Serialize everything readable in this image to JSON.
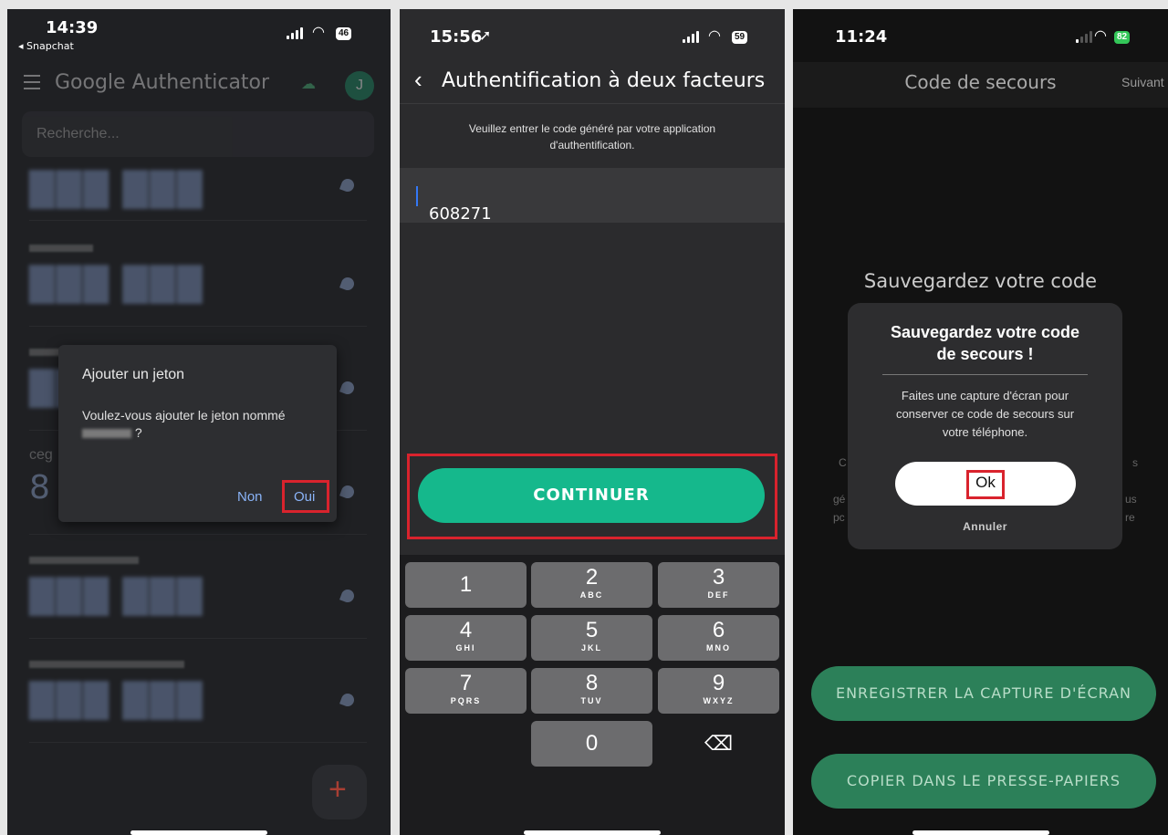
{
  "colors": {
    "highlight": "#d9232d",
    "teal": "#15b88c",
    "green": "#2c8059",
    "link_blue": "#8ab4f8"
  },
  "panel1": {
    "status": {
      "time": "14:39",
      "battery": "46",
      "back_app": "◂ Snapchat"
    },
    "app_title": "Google Authenticator",
    "avatar_letter": "J",
    "search_placeholder": "Recherche...",
    "token_partial_name": "ceg",
    "token_partial_code": "8",
    "dialog": {
      "title": "Ajouter un jeton",
      "message": "Voulez-vous ajouter le jeton nommé",
      "message_suffix": " ?",
      "no_label": "Non",
      "yes_label": "Oui"
    },
    "icons": [
      "menu-icon",
      "cloud-sync-icon",
      "countdown-pie-icon",
      "add-icon"
    ]
  },
  "panel2": {
    "status": {
      "time": "15:56",
      "location_arrow": "➚",
      "battery": "59"
    },
    "nav_title": "Authentification à deux facteurs",
    "instruction_line1": "Veuillez entrer le code généré par votre application",
    "instruction_line2": "d'authentification.",
    "code_value": "608271",
    "continue_label": "CONTINUER",
    "keys": [
      {
        "digit": "1",
        "letters": ""
      },
      {
        "digit": "2",
        "letters": "ABC"
      },
      {
        "digit": "3",
        "letters": "DEF"
      },
      {
        "digit": "4",
        "letters": "GHI"
      },
      {
        "digit": "5",
        "letters": "JKL"
      },
      {
        "digit": "6",
        "letters": "MNO"
      },
      {
        "digit": "7",
        "letters": "PQRS"
      },
      {
        "digit": "8",
        "letters": "TUV"
      },
      {
        "digit": "9",
        "letters": "WXYZ"
      },
      {
        "digit": "0",
        "letters": ""
      }
    ],
    "delete_symbol": "⌫"
  },
  "panel3": {
    "status": {
      "time": "11:24",
      "battery": "82"
    },
    "nav_title": "Code de secours",
    "nav_next": "Suivant",
    "bg_heading": "Sauvegardez votre code",
    "bg_fragments": [
      "C",
      "gé",
      "pc",
      "s",
      "us",
      "re"
    ],
    "dialog": {
      "title_line1": "Sauvegardez votre code",
      "title_line2": "de secours !",
      "msg_line1": "Faites une capture d'écran pour",
      "msg_line2": "conserver ce code de secours sur",
      "msg_line3": "votre téléphone.",
      "ok_label": "Ok",
      "cancel_label": "Annuler"
    },
    "save_screenshot_label": "ENREGISTRER LA CAPTURE D'ÉCRAN",
    "copy_label": "COPIER DANS LE PRESSE-PAPIERS"
  }
}
